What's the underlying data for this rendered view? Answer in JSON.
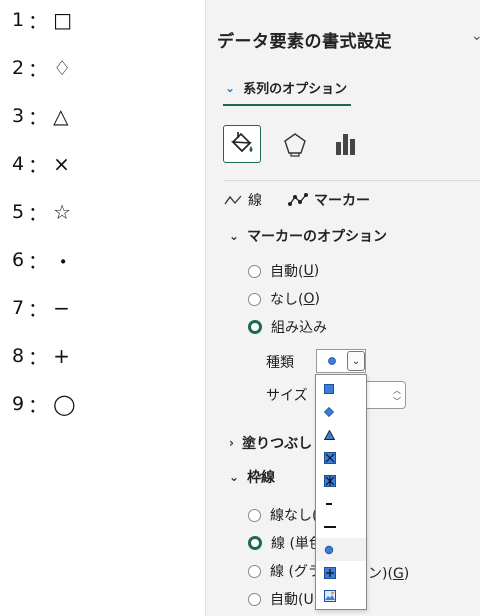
{
  "legend_list": [
    {
      "num": "1",
      "sep": "：",
      "sym": "□"
    },
    {
      "num": "2",
      "sep": "：",
      "sym": "♢"
    },
    {
      "num": "3",
      "sep": "：",
      "sym": "△"
    },
    {
      "num": "4",
      "sep": "：",
      "sym": "×"
    },
    {
      "num": "5",
      "sep": "：",
      "sym": "☆"
    },
    {
      "num": "6",
      "sep": "：",
      "sym": "・"
    },
    {
      "num": "7",
      "sep": "：",
      "sym": "−"
    },
    {
      "num": "8",
      "sep": "：",
      "sym": "+"
    },
    {
      "num": "9",
      "sep": "：",
      "sym": "◯"
    }
  ],
  "pane": {
    "title": "データ要素の書式設定",
    "close_glyph": "⌄",
    "series_options_label": "系列のオプション",
    "tabs": {
      "fill_line": "fill-line-icon",
      "effects": "pentagon-effects-icon",
      "series": "bar-series-icon"
    },
    "subtabs": {
      "line_label": "線",
      "marker_label": "マーカー"
    },
    "marker_options": {
      "heading": "マーカーのオプション",
      "auto": "自動(",
      "auto_key": "U",
      "none": "なし(",
      "none_key": "O",
      "builtin": "組み込み",
      "close_paren": ")",
      "type_label": "種類",
      "size_label": "サイズ"
    },
    "fill": {
      "heading": "塗りつぶし"
    },
    "border": {
      "heading": "枠線",
      "no_line": "線なし(",
      "solid_line": "線 (単色",
      "gradient_line": "線 (グラ",
      "gradient_suffix": "ン)(",
      "gradient_key": "G",
      "auto": "自動(U",
      "close_paren": ")"
    },
    "dropdown_items": [
      "square-marker",
      "diamond-marker",
      "triangle-marker",
      "x-marker",
      "star-marker",
      "short-dash-marker",
      "long-dash-marker",
      "circle-marker",
      "plus-marker",
      "picture-marker"
    ],
    "colors": {
      "accent_green": "#1d6b48",
      "marker_blue": "#3b7dd8",
      "link_blue": "#1a73c7"
    }
  }
}
